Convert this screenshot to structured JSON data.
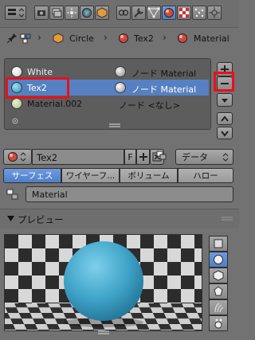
{
  "colors": {
    "accent": "#5680c2",
    "highlight_box": "#e8101c",
    "sphere": "#3fa3c7"
  },
  "toolbar": {
    "icons": [
      "editor-type-icon",
      "render-icon",
      "render-layers-icon",
      "scene-icon",
      "world-icon",
      "object-icon",
      "constraints-icon",
      "modifiers-icon",
      "data-icon",
      "material-icon",
      "texture-icon",
      "particles-icon",
      "physics-icon"
    ]
  },
  "breadcrumb": {
    "object": "Circle",
    "material": "Tex2",
    "context": "Material"
  },
  "material_slots": [
    {
      "name": "White",
      "node_label": "ノード Material",
      "selected": false,
      "ball_color": "#eaeaea"
    },
    {
      "name": "Tex2",
      "node_label": "ノード Material",
      "selected": true,
      "ball_color": "#3fa3c7"
    },
    {
      "name": "Material.002",
      "node_label": "ノード <なし>",
      "selected": false,
      "ball_color": "#bcd49a"
    }
  ],
  "datablock": {
    "name": "Tex2",
    "fake_user": "F",
    "browse_label": "データ"
  },
  "tabs": [
    "サーフェス",
    "ワイヤーフ...",
    "ボリューム",
    "ハロー"
  ],
  "active_tab": 0,
  "node_material": "Material",
  "preview": {
    "title": "プレビュー"
  }
}
